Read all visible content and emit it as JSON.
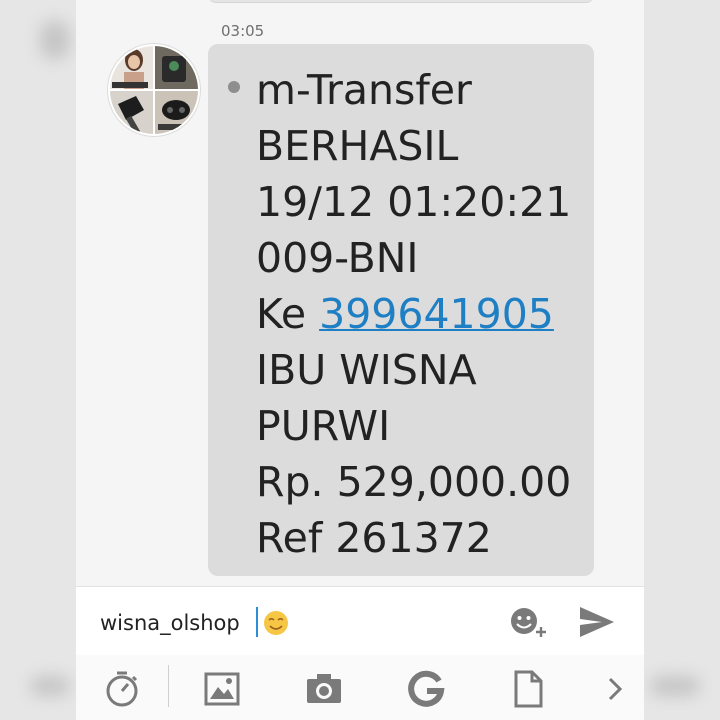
{
  "message": {
    "time": "03:05",
    "lines": {
      "l1": "m-Transfer",
      "l2": "BERHASIL",
      "l3": "19/12 01:20:21",
      "l4": "009-BNI",
      "l5_prefix": "Ke ",
      "l5_link": "399641905",
      "l6": "IBU WISNA",
      "l7": "PURWI",
      "l8": "Rp. 529,000.00",
      "l9": "Ref 261372"
    }
  },
  "composer": {
    "text": "wisna_olshop"
  },
  "icons": {
    "avatar": "avatar",
    "inline_emoji": "smiling-face-icon",
    "emoji_button": "emoji-add-icon",
    "send": "send-icon",
    "timer": "timer-icon",
    "gallery": "image-icon",
    "camera": "camera-icon",
    "g_tool": "g-logo-icon",
    "document": "document-icon",
    "more": "chevron-right-icon"
  },
  "colors": {
    "bubble": "#dcdcdc",
    "link": "#1e7fc4",
    "accent_icon": "#7a7a7a",
    "emoji": "#f6c744"
  }
}
